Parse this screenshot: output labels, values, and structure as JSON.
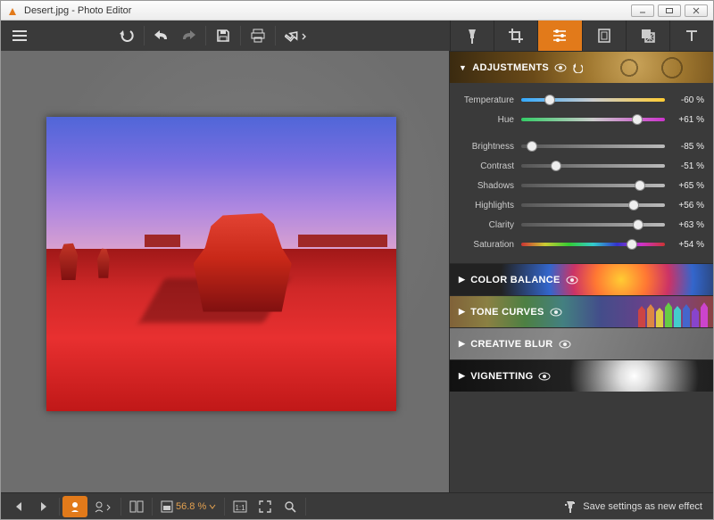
{
  "window": {
    "title": "Desert.jpg - Photo Editor"
  },
  "toolbar": {
    "icons": [
      "menu",
      "undo-step",
      "undo",
      "redo",
      "save",
      "print",
      "export"
    ]
  },
  "side_tabs": [
    "effects",
    "crop",
    "adjust",
    "frame",
    "pattern",
    "text"
  ],
  "side_tabs_active": 2,
  "sections": {
    "adjustments": {
      "label": "ADJUSTMENTS",
      "open": true
    },
    "color_balance": {
      "label": "COLOR BALANCE",
      "open": false
    },
    "tone_curves": {
      "label": "TONE CURVES",
      "open": false
    },
    "creative_blur": {
      "label": "CREATIVE BLUR",
      "open": false
    },
    "vignetting": {
      "label": "VIGNETTING",
      "open": false
    }
  },
  "sliders": {
    "temperature": {
      "label": "Temperature",
      "value": -60,
      "display": "-60 %",
      "track": "temp"
    },
    "hue": {
      "label": "Hue",
      "value": 61,
      "display": "+61 %",
      "track": "hue"
    },
    "brightness": {
      "label": "Brightness",
      "value": -85,
      "display": "-85 %",
      "track": "gray"
    },
    "contrast": {
      "label": "Contrast",
      "value": -51,
      "display": "-51 %",
      "track": "gray"
    },
    "shadows": {
      "label": "Shadows",
      "value": 65,
      "display": "+65 %",
      "track": "gray"
    },
    "highlights": {
      "label": "Highlights",
      "value": 56,
      "display": "+56 %",
      "track": "gray"
    },
    "clarity": {
      "label": "Clarity",
      "value": 63,
      "display": "+63 %",
      "track": "gray"
    },
    "saturation": {
      "label": "Saturation",
      "value": 54,
      "display": "+54 %",
      "track": "rainbow"
    }
  },
  "statusbar": {
    "zoom": "56.8 %",
    "save_effect": "Save settings as new effect"
  }
}
